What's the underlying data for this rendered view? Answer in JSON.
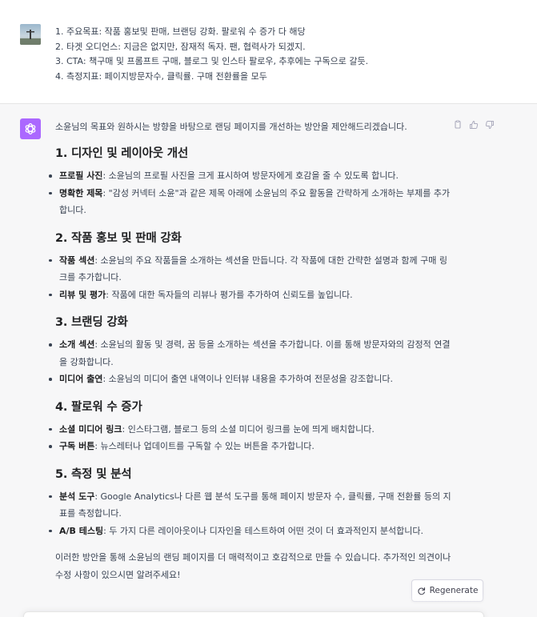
{
  "user_message": {
    "lines": [
      "1. 주요목표: 작품 홍보및 판매, 브랜딩 강화. 팔로워 수 증가 다 해당",
      "2. 타겟 오디언스: 지금은 없지만, 잠재적 독자. 팬, 협력사가 되겠지.",
      "3. CTA: 책구매 및 프롬프트 구매, 블로그 및 인스타 팔로우, 추후에는 구독으로 갈듯.",
      "4. 측정지표: 페이지방문자수, 클릭률. 구매 전환률을 모두"
    ]
  },
  "assistant_message": {
    "intro": "소윤님의 목표와 원하시는 방향을 바탕으로 랜딩 페이지를 개선하는 방안을 제안해드리겠습니다.",
    "sections": [
      {
        "heading": "1. 디자인 및 레이아웃 개선",
        "bullets": [
          {
            "term": "프로필 사진",
            "text": ": 소윤님의 프로필 사진을 크게 표시하여 방문자에게 호감을 줄 수 있도록 합니다."
          },
          {
            "term": "명확한 제목",
            "text": ": \"감성 커넥터 소윤\"과 같은 제목 아래에 소윤님의 주요 활동을 간략하게 소개하는 부제를 추가합니다."
          }
        ]
      },
      {
        "heading": "2. 작품 홍보 및 판매 강화",
        "bullets": [
          {
            "term": "작품 섹션",
            "text": ": 소윤님의 주요 작품들을 소개하는 섹션을 만듭니다. 각 작품에 대한 간략한 설명과 함께 구매 링크를 추가합니다."
          },
          {
            "term": "리뷰 및 평가",
            "text": ": 작품에 대한 독자들의 리뷰나 평가를 추가하여 신뢰도를 높입니다."
          }
        ]
      },
      {
        "heading": "3. 브랜딩 강화",
        "bullets": [
          {
            "term": "소개 섹션",
            "text": ": 소윤님의 활동 및 경력, 꿈 등을 소개하는 섹션을 추가합니다. 이를 통해 방문자와의 감정적 연결을 강화합니다."
          },
          {
            "term": "미디어 출연",
            "text": ": 소윤님의 미디어 출연 내역이나 인터뷰 내용을 추가하여 전문성을 강조합니다."
          }
        ]
      },
      {
        "heading": "4. 팔로워 수 증가",
        "bullets": [
          {
            "term": "소셜 미디어 링크",
            "text": ": 인스타그램, 블로그 등의 소셜 미디어 링크를 눈에 띄게 배치합니다."
          },
          {
            "term": "구독 버튼",
            "text": ": 뉴스레터나 업데이트를 구독할 수 있는 버튼을 추가합니다."
          }
        ]
      },
      {
        "heading": "5. 측정 및 분석",
        "bullets": [
          {
            "term": "분석 도구",
            "text": ": Google Analytics나 다른 웹 분석 도구를 통해 페이지 방문자 수, 클릭률, 구매 전환률 등의 지표를 측정합니다."
          },
          {
            "term": "A/B 테스팅",
            "text": ": 두 가지 다른 레이아웃이나 디자인을 테스트하여 어떤 것이 더 효과적인지 분석합니다."
          }
        ]
      }
    ],
    "closing": "이러한 방안을 통해 소윤님의 랜딩 페이지를 더 매력적이고 호감적으로 만들 수 있습니다. 추가적인 의견이나 수정 사항이 있으시면 알려주세요!"
  },
  "regenerate": {
    "label": "Regenerate",
    "icon": "refresh-icon"
  },
  "icons": {
    "copy": "copy-icon",
    "like": "thumbs-up-icon",
    "dislike": "thumbs-down-icon",
    "assistant": "openai-logo-icon"
  },
  "colors": {
    "assistant_avatar": "#ab68ff",
    "assistant_bg": "#f7f7f8",
    "user_bg": "#ffffff"
  }
}
